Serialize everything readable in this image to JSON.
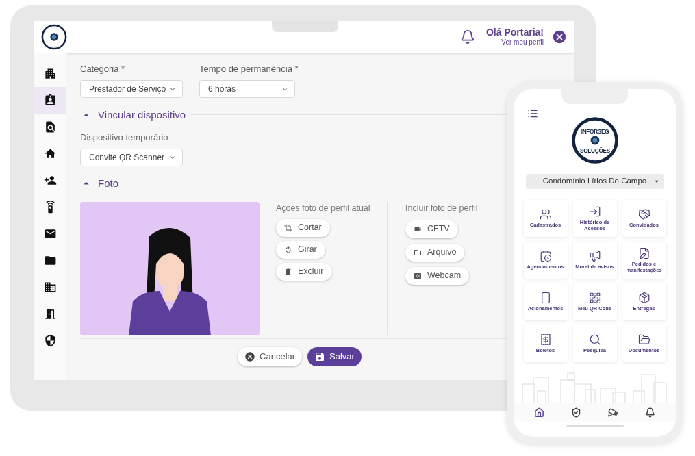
{
  "tablet": {
    "header": {
      "greeting": "Olá Portaria!",
      "profile_link": "Ver meu perfil"
    },
    "sidebar": {
      "items": [
        {
          "kind": "buildings",
          "selected": false
        },
        {
          "kind": "badge",
          "selected": true
        },
        {
          "kind": "document-search",
          "selected": false
        },
        {
          "kind": "home",
          "selected": false
        },
        {
          "kind": "add-person",
          "selected": false
        },
        {
          "kind": "remote",
          "selected": false
        },
        {
          "kind": "mail",
          "selected": false
        },
        {
          "kind": "folder",
          "selected": false
        },
        {
          "kind": "company",
          "selected": false
        },
        {
          "kind": "door",
          "selected": false
        },
        {
          "kind": "shield",
          "selected": false
        }
      ]
    },
    "fields": [
      {
        "label": "Categoria *",
        "value": "Prestador de Serviço"
      },
      {
        "label": "Tempo de permanência *",
        "value": "6 horas"
      }
    ],
    "device_section": {
      "title": "Vincular dispositivo",
      "expanded": true,
      "field": {
        "label": "Dispositivo temporário",
        "value": "Convite QR Scanner"
      }
    },
    "photo_section": {
      "title": "Foto",
      "expanded": true,
      "current_actions": {
        "title": "Ações foto de perfil atual",
        "buttons": [
          {
            "kind": "crop",
            "label": "Cortar"
          },
          {
            "kind": "rotate",
            "label": "Girar"
          },
          {
            "kind": "delete",
            "label": "Excluir"
          }
        ]
      },
      "include": {
        "title": "Incluir foto de perfil",
        "buttons": [
          {
            "kind": "cctv",
            "label": "CFTV"
          },
          {
            "kind": "file",
            "label": "Arquivo"
          },
          {
            "kind": "webcam",
            "label": "Webcam"
          }
        ]
      }
    },
    "actions": [
      {
        "kind": "cancel",
        "label": "Cancelar"
      },
      {
        "kind": "save",
        "label": "Salvar"
      }
    ]
  },
  "phone": {
    "logo": {
      "top": "INFORSEG",
      "bottom": "SOLUÇÕES"
    },
    "condominium": "Condomínio Lírios Do Campo",
    "tiles": [
      {
        "kind": "people",
        "label": "Cadastrados"
      },
      {
        "kind": "entry",
        "label": "Histórico de Acessos"
      },
      {
        "kind": "guests",
        "label": "Convidados"
      },
      {
        "kind": "calendar",
        "label": "Agendamentos"
      },
      {
        "kind": "megaphone",
        "label": "Mural de avisos"
      },
      {
        "kind": "request",
        "label": "Pedidos e manifestações"
      },
      {
        "kind": "remote",
        "label": "Acionamentos"
      },
      {
        "kind": "qr",
        "label": "Meu QR Code"
      },
      {
        "kind": "delivery",
        "label": "Entregas"
      },
      {
        "kind": "bill",
        "label": "Boletos"
      },
      {
        "kind": "search",
        "label": "Pesquisa"
      },
      {
        "kind": "folder",
        "label": "Documentos"
      }
    ],
    "nav": [
      {
        "kind": "home",
        "selected": true
      },
      {
        "kind": "shield",
        "selected": false
      },
      {
        "kind": "camera",
        "selected": false
      },
      {
        "kind": "bell",
        "selected": false
      }
    ]
  }
}
